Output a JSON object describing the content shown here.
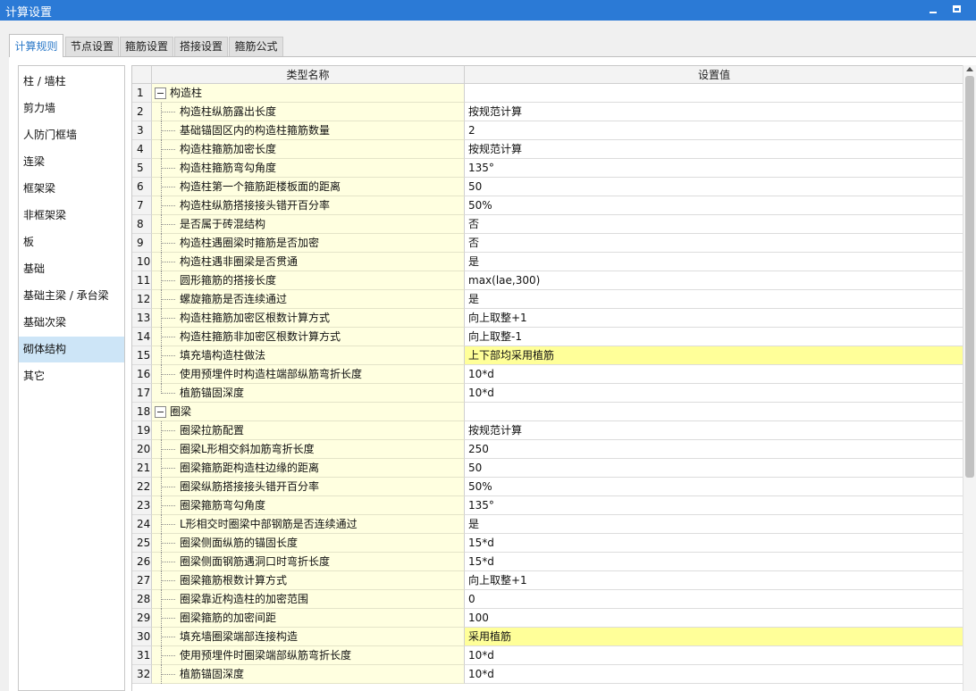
{
  "window": {
    "title": "计算设置"
  },
  "tabs": [
    {
      "label": "计算规则",
      "active": true
    },
    {
      "label": "节点设置",
      "active": false
    },
    {
      "label": "箍筋设置",
      "active": false
    },
    {
      "label": "搭接设置",
      "active": false
    },
    {
      "label": "箍筋公式",
      "active": false
    }
  ],
  "sidebar": {
    "items": [
      {
        "label": "柱 / 墙柱"
      },
      {
        "label": "剪力墙"
      },
      {
        "label": "人防门框墙"
      },
      {
        "label": "连梁"
      },
      {
        "label": "框架梁"
      },
      {
        "label": "非框架梁"
      },
      {
        "label": "板"
      },
      {
        "label": "基础"
      },
      {
        "label": "基础主梁 / 承台梁"
      },
      {
        "label": "基础次梁"
      },
      {
        "label": "砌体结构",
        "selected": true
      },
      {
        "label": "其它"
      }
    ]
  },
  "grid": {
    "columns": {
      "name": "类型名称",
      "value": "设置值"
    },
    "rows": [
      {
        "num": "1",
        "name": "构造柱",
        "value": "",
        "type": "category"
      },
      {
        "num": "2",
        "name": "构造柱纵筋露出长度",
        "value": "按规范计算"
      },
      {
        "num": "3",
        "name": "基础锚固区内的构造柱箍筋数量",
        "value": "2"
      },
      {
        "num": "4",
        "name": "构造柱箍筋加密长度",
        "value": "按规范计算"
      },
      {
        "num": "5",
        "name": "构造柱箍筋弯勾角度",
        "value": "135°"
      },
      {
        "num": "6",
        "name": "构造柱第一个箍筋距楼板面的距离",
        "value": "50"
      },
      {
        "num": "7",
        "name": "构造柱纵筋搭接接头错开百分率",
        "value": "50%"
      },
      {
        "num": "8",
        "name": "是否属于砖混结构",
        "value": "否"
      },
      {
        "num": "9",
        "name": "构造柱遇圈梁时箍筋是否加密",
        "value": "否"
      },
      {
        "num": "10",
        "name": "构造柱遇非圈梁是否贯通",
        "value": "是"
      },
      {
        "num": "11",
        "name": "圆形箍筋的搭接长度",
        "value": "max(lae,300)"
      },
      {
        "num": "12",
        "name": "螺旋箍筋是否连续通过",
        "value": "是"
      },
      {
        "num": "13",
        "name": "构造柱箍筋加密区根数计算方式",
        "value": "向上取整+1"
      },
      {
        "num": "14",
        "name": "构造柱箍筋非加密区根数计算方式",
        "value": "向上取整-1"
      },
      {
        "num": "15",
        "name": "填充墙构造柱做法",
        "value": "上下部均采用植筋",
        "highlight": true
      },
      {
        "num": "16",
        "name": "使用预埋件时构造柱端部纵筋弯折长度",
        "value": "10*d"
      },
      {
        "num": "17",
        "name": "植筋锚固深度",
        "value": "10*d",
        "last": true
      },
      {
        "num": "18",
        "name": "圈梁",
        "value": "",
        "type": "category"
      },
      {
        "num": "19",
        "name": "圈梁拉筋配置",
        "value": "按规范计算"
      },
      {
        "num": "20",
        "name": "圈梁L形相交斜加筋弯折长度",
        "value": "250"
      },
      {
        "num": "21",
        "name": "圈梁箍筋距构造柱边缘的距离",
        "value": "50"
      },
      {
        "num": "22",
        "name": "圈梁纵筋搭接接头错开百分率",
        "value": "50%"
      },
      {
        "num": "23",
        "name": "圈梁箍筋弯勾角度",
        "value": "135°"
      },
      {
        "num": "24",
        "name": "L形相交时圈梁中部钢筋是否连续通过",
        "value": "是"
      },
      {
        "num": "25",
        "name": "圈梁侧面纵筋的锚固长度",
        "value": "15*d"
      },
      {
        "num": "26",
        "name": "圈梁侧面钢筋遇洞口时弯折长度",
        "value": "15*d"
      },
      {
        "num": "27",
        "name": "圈梁箍筋根数计算方式",
        "value": "向上取整+1"
      },
      {
        "num": "28",
        "name": "圈梁靠近构造柱的加密范围",
        "value": "0"
      },
      {
        "num": "29",
        "name": "圈梁箍筋的加密间距",
        "value": "100"
      },
      {
        "num": "30",
        "name": "填充墙圈梁端部连接构造",
        "value": "采用植筋",
        "highlight": true
      },
      {
        "num": "31",
        "name": "使用预埋件时圈梁端部纵筋弯折长度",
        "value": "10*d"
      },
      {
        "num": "32",
        "name": "植筋锚固深度",
        "value": "10*d"
      }
    ]
  }
}
